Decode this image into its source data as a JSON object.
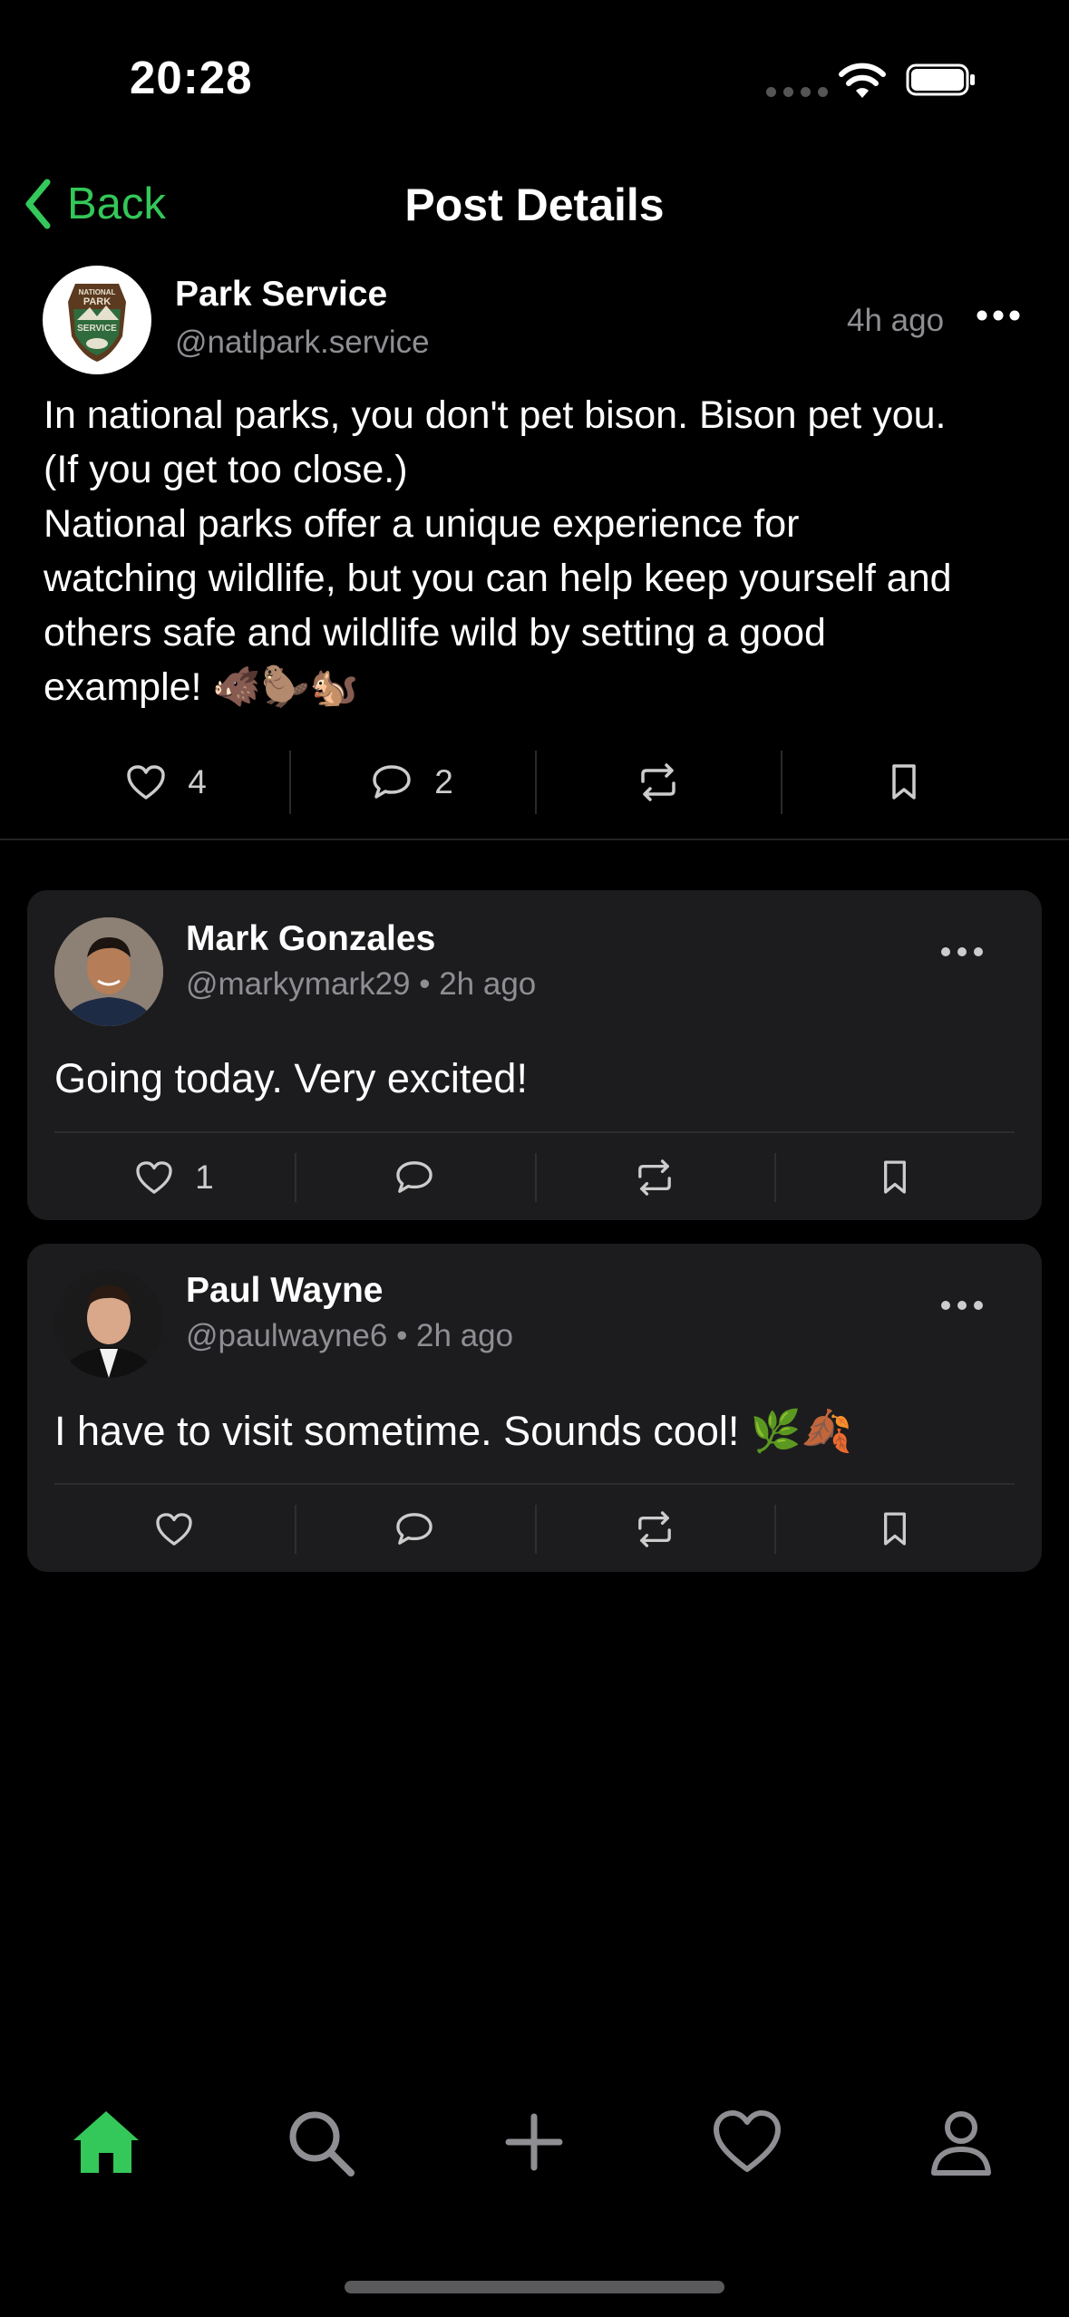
{
  "status_bar": {
    "time": "20:28"
  },
  "nav": {
    "back_label": "Back",
    "title": "Post Details"
  },
  "post": {
    "author_name": "Park Service",
    "author_handle": "@natlpark.service",
    "time": "4h ago",
    "avatar_text": [
      "NATIONAL",
      "PARK",
      "SERVICE"
    ],
    "lines": [
      "In national parks, you don't pet bison. Bison pet you.",
      "(If you get too close.)",
      "National parks offer a unique experience for",
      "watching wildlife, but you can help keep yourself and",
      "others safe and wildlife wild by setting a good",
      "example! 🐗🦫🐿️"
    ],
    "likes": "4",
    "comments": "2"
  },
  "comments": [
    {
      "name": "Mark Gonzales",
      "handle": "@markymark29",
      "time": "2h ago",
      "text": "Going today. Very excited!",
      "likes": "1"
    },
    {
      "name": "Paul Wayne",
      "handle": "@paulwayne6",
      "time": "2h ago",
      "text": "I have to visit sometime. Sounds cool! 🌿🍂",
      "likes": ""
    }
  ],
  "tabs": [
    {
      "icon": "home-icon",
      "active": true
    },
    {
      "icon": "search-icon",
      "active": false
    },
    {
      "icon": "plus-icon",
      "active": false
    },
    {
      "icon": "heart-icon",
      "active": false
    },
    {
      "icon": "profile-icon",
      "active": false
    }
  ],
  "colors": {
    "accent": "#34c759",
    "background": "#000000",
    "card": "#1c1c1e",
    "secondary_text": "#8e8e93"
  }
}
